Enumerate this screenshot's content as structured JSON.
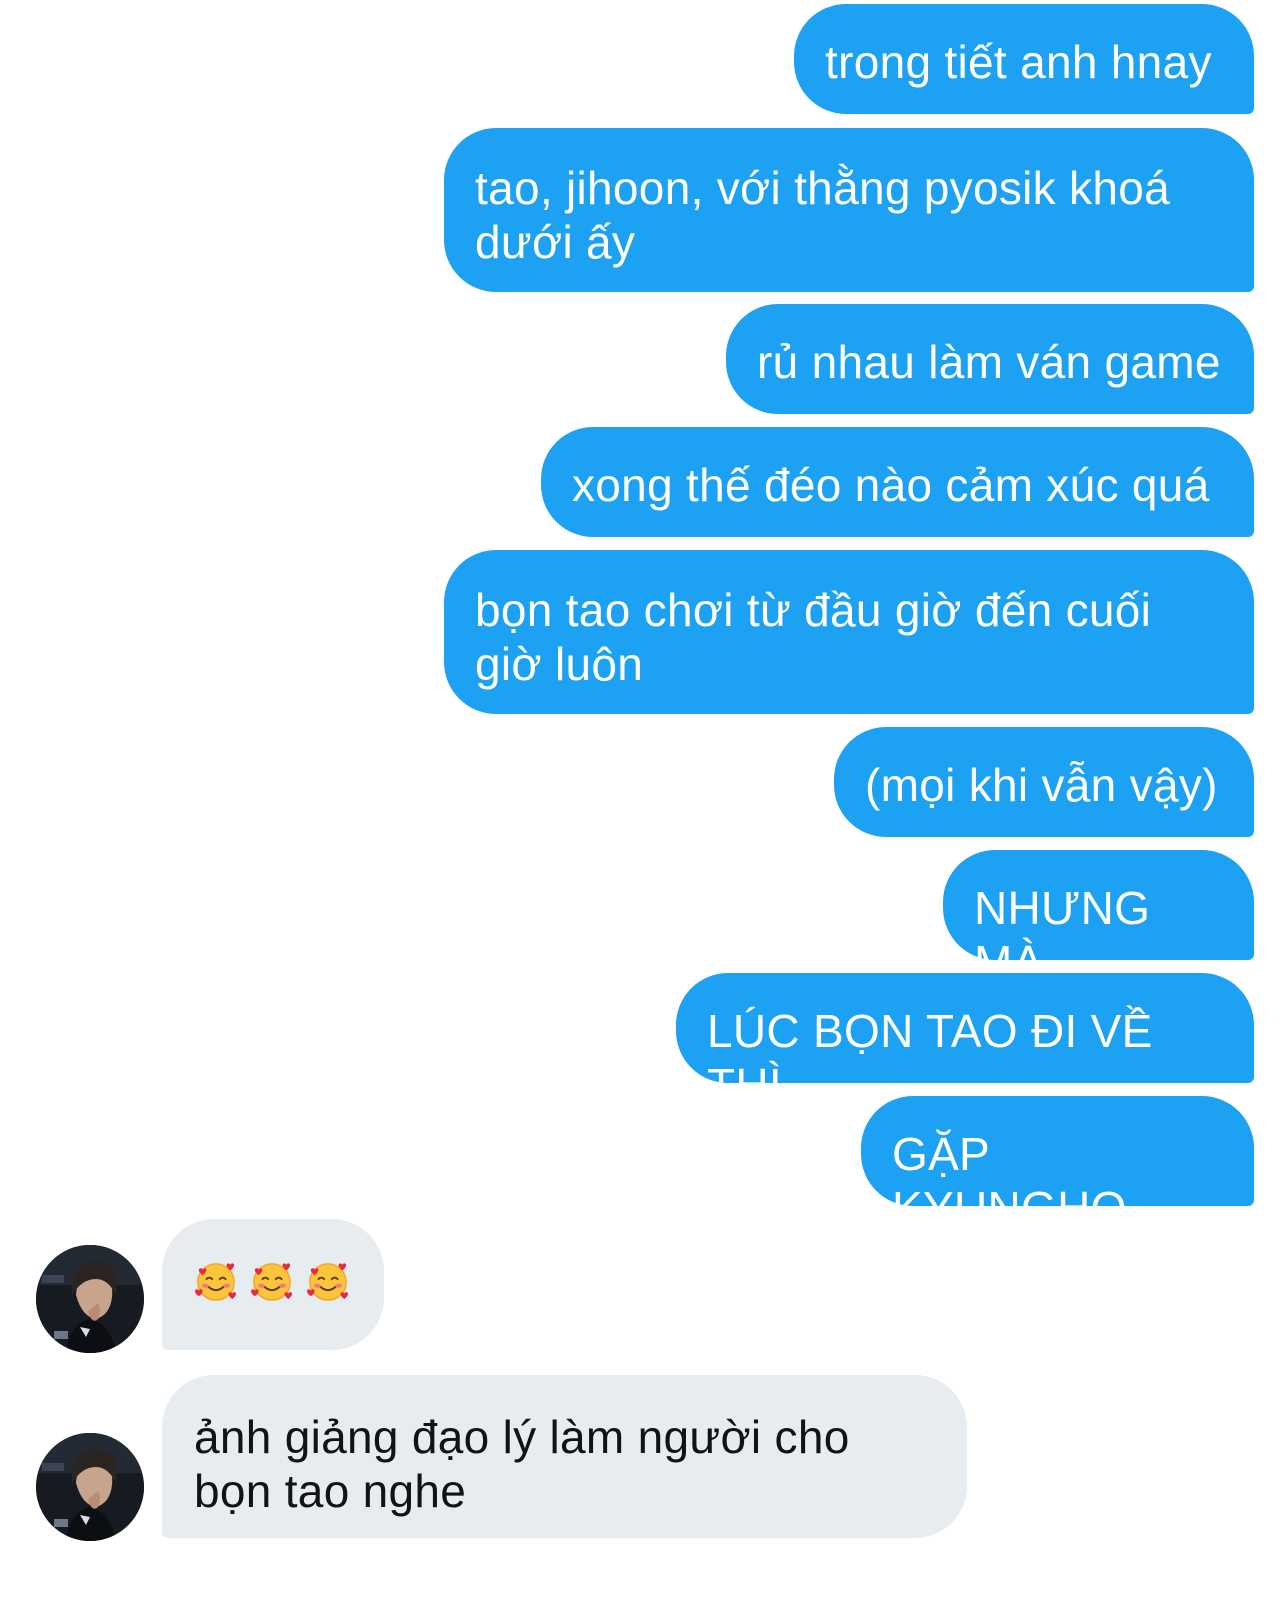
{
  "conversation": {
    "sent_messages": [
      {
        "text": "trong tiết anh hnay"
      },
      {
        "text": "tao, jihoon, với thằng pyosik khoá dưới ấy"
      },
      {
        "text": "rủ nhau làm ván game"
      },
      {
        "text": "xong thế đéo nào cảm xúc quá"
      },
      {
        "text": "bọn tao chơi từ đầu giờ đến cuối giờ luôn"
      },
      {
        "text": "(mọi khi vẫn vậy)"
      },
      {
        "text": "NHƯNG MÀ"
      },
      {
        "text": "LÚC BỌN TAO ĐI VỀ THÌ"
      },
      {
        "text": "GẶP KYUNGHO"
      }
    ],
    "received_messages": [
      {
        "emojis": [
          "smiling-face-with-hearts",
          "smiling-face-with-hearts",
          "smiling-face-with-hearts"
        ]
      },
      {
        "text": "ảnh giảng đạo lý làm người cho bọn tao nghe"
      }
    ]
  },
  "colors": {
    "sent_bubble": "#1da1f2",
    "sent_text": "#ffffff",
    "received_bubble": "#e6ecf0",
    "received_text": "#0f1419",
    "background": "#ffffff"
  }
}
